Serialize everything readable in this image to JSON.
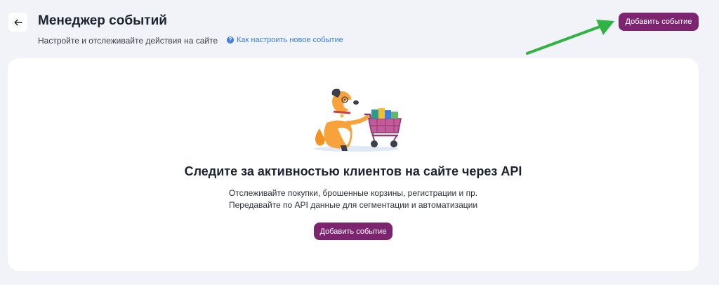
{
  "header": {
    "back_icon": "arrow-left-icon",
    "title": "Менеджер событий",
    "subtitle": "Настройте и отслеживайте действия на сайте",
    "help_icon": "question-circle-icon",
    "help_link": "Как настроить новое событие",
    "add_button": "Добавить событие"
  },
  "empty_state": {
    "illustration": "dog-with-shopping-cart",
    "title": "Следите за активностью клиентов на сайте через API",
    "line1": "Отслеживайте покупки, брошенные корзины, регистрации и пр.",
    "line2": "Передавайте по API данные для сегментации и автоматизации",
    "add_button": "Добавить событие"
  },
  "annotation": {
    "arrow_color": "#2fb344"
  },
  "colors": {
    "accent": "#7d2470",
    "link": "#3b7de0",
    "background": "#f1f3f8"
  }
}
